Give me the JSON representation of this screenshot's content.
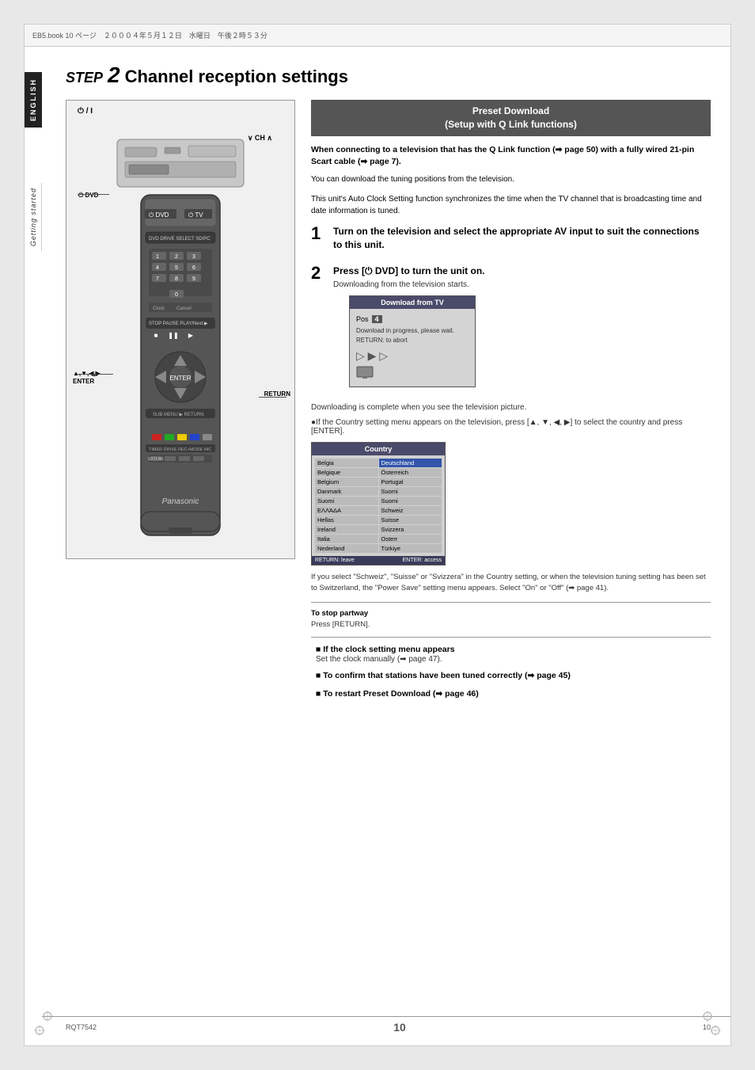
{
  "page": {
    "top_bar_text": "EB5.book  10  ページ　２０００４年５月１２日　水曜日　午後２時５３分",
    "page_number": "10",
    "model_number": "RQT7542"
  },
  "side_tabs": {
    "english_label": "ENGLISH",
    "getting_started_label": "Getting started"
  },
  "step_title": {
    "step_word": "STEP",
    "step_number": "2",
    "title_text": "Channel reception settings"
  },
  "preset_box": {
    "line1": "Preset Download",
    "line2": "(Setup with Q Link functions)"
  },
  "intro": {
    "bold_text": "When connecting to a television that has the Q Link function (➡ page 50) with a fully wired 21-pin Scart cable (➡ page 7).",
    "normal_text1": "You can download the tuning positions from the television.",
    "normal_text2": "This unit's Auto Clock Setting function synchronizes the time when the TV channel that is broadcasting time and date information is tuned."
  },
  "steps": [
    {
      "number": "1",
      "main_text": "Turn on the television and select the appropriate AV input to suit the connections to this unit.",
      "sub_text": ""
    },
    {
      "number": "2",
      "main_text": "Press [⏻ DVD] to turn the unit on.",
      "sub_text": "Downloading from the television starts."
    }
  ],
  "download_box": {
    "title": "Download from TV",
    "pos_label": "Pos",
    "pos_value": "4",
    "progress_line1": "Download in progress, please wait.",
    "progress_line2": "RETURN: to abort",
    "arrows": "▷ ▶ ▷"
  },
  "download_complete_text": "Downloading is complete when you see the television picture.",
  "country_note": "●If the Country setting menu appears on the television, press [▲, ▼, ◀, ▶] to select the country and press [ENTER].",
  "country_box": {
    "title": "Country",
    "items_left": [
      "Belgia",
      "Belgique",
      "Belgium",
      "Danmark",
      "Suomi",
      "ΕΛΛΆΔΑ",
      "Hellas",
      "Ireland",
      "Italia",
      "Nederland"
    ],
    "items_right": [
      "Deutschland",
      "Portugal",
      "Suomi",
      "Suomi",
      "Suisse",
      "Schweiz",
      "Suomi",
      "Svizzera",
      "Osterr",
      "Turkiye"
    ],
    "footer_return": "RETURN: leave",
    "footer_enter": "ENTER: access"
  },
  "swiss_note": "If you select \"Schweiz\", \"Suisse\" or \"Svizzera\" in the Country setting, or when the television tuning setting has been set to Switzerland, the \"Power Save\" setting menu appears. Select \"On\" or \"Off\" (➡ page 41).",
  "stop_partway": {
    "title": "To stop partway",
    "text": "Press [RETURN]."
  },
  "bullet_items": [
    {
      "title": "■ If the clock setting menu appears",
      "text": "Set the clock manually (➡ page 47)."
    },
    {
      "title": "■ To confirm that stations have been tuned correctly (➡ page 45)"
    },
    {
      "title": "■ To restart Preset Download (➡ page 46)"
    }
  ],
  "remote": {
    "power_label": "⏻ / I",
    "dvd_label": "⏻ DVD",
    "enter_label": "▲,▼,◀,▶\nENTER",
    "return_label": "RETURN",
    "ch_label": "∨ CH ∧"
  }
}
